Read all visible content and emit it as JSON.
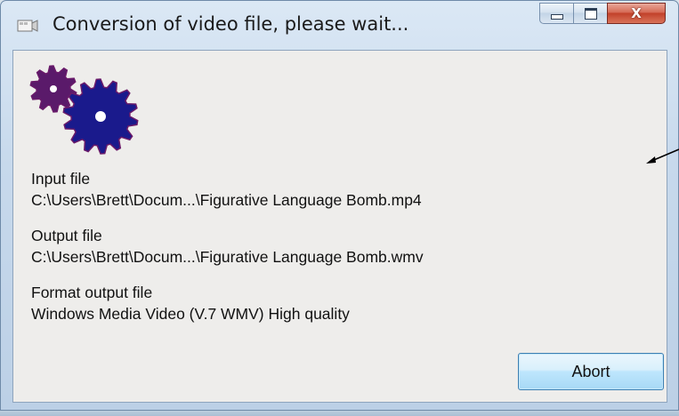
{
  "window": {
    "title": "Conversion of video file, please wait...",
    "icons": {
      "app": "video-conversion-icon",
      "minimize": "minimize-icon",
      "maximize": "maximize-icon",
      "close": "close-icon"
    },
    "close_glyph": "X"
  },
  "content": {
    "icon": "gears-icon",
    "input": {
      "label": "Input file",
      "value": "C:\\Users\\Brett\\Docum...\\Figurative Language Bomb.mp4"
    },
    "output": {
      "label": "Output file",
      "value": "C:\\Users\\Brett\\Docum...\\Figurative Language Bomb.wmv"
    },
    "format": {
      "label": "Format output file",
      "value": "Windows Media Video (V.7 WMV) High quality"
    },
    "abort_label": "Abort"
  },
  "colors": {
    "gear_large": "#1a1a8c",
    "gear_small": "#5a1a6a",
    "button_border": "#3c7fb1",
    "close_button": "#c2412a"
  }
}
